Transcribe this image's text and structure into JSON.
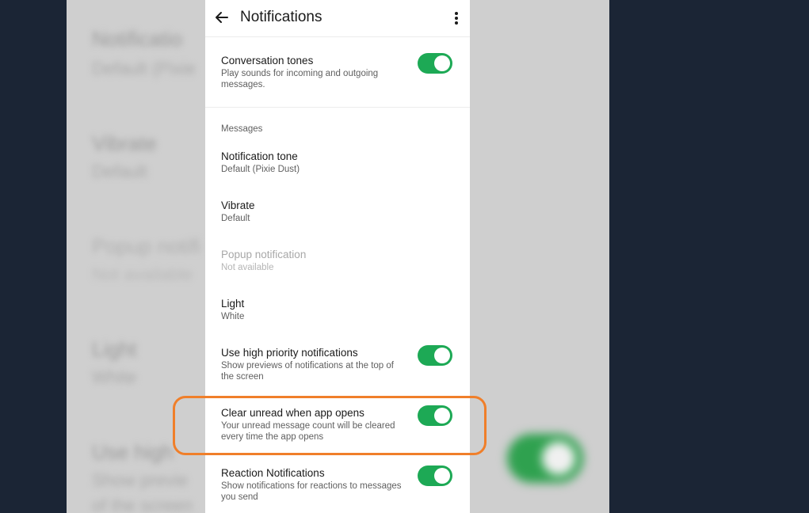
{
  "app_bar": {
    "title": "Notifications",
    "back_icon": "arrow-left-icon",
    "menu_icon": "more-vert-icon"
  },
  "conversation_tones": {
    "title": "Conversation tones",
    "subtitle": "Play sounds for incoming and outgoing messages.",
    "enabled": true
  },
  "messages_section": {
    "label": "Messages",
    "notification_tone": {
      "title": "Notification tone",
      "subtitle": "Default (Pixie Dust)"
    },
    "vibrate": {
      "title": "Vibrate",
      "subtitle": "Default"
    },
    "popup_notification": {
      "title": "Popup notification",
      "subtitle": "Not available"
    },
    "light": {
      "title": "Light",
      "subtitle": "White"
    },
    "high_priority": {
      "title": "Use high priority notifications",
      "subtitle": "Show previews of notifications at the top of the screen",
      "enabled": true
    },
    "clear_unread": {
      "title": "Clear unread when app opens",
      "subtitle": "Your unread message count will be cleared every time the app opens",
      "enabled": true
    },
    "reaction_notifications": {
      "title": "Reaction Notifications",
      "subtitle": "Show notifications for reactions to messages you send",
      "enabled": true
    }
  },
  "background_blur": {
    "t1": "Notificatio",
    "s1": "Default (Pixie",
    "t2": "Vibrate",
    "s2": "Default",
    "t3": "Popup notifi",
    "s3": "Not available",
    "t4": "Light",
    "s4": "White",
    "t5": "Use high",
    "s5": "Show previe",
    "s6": "of the screen"
  },
  "colors": {
    "toggle_on": "#1da955",
    "highlight": "#f07f2a",
    "page_bg": "#1b2535"
  }
}
